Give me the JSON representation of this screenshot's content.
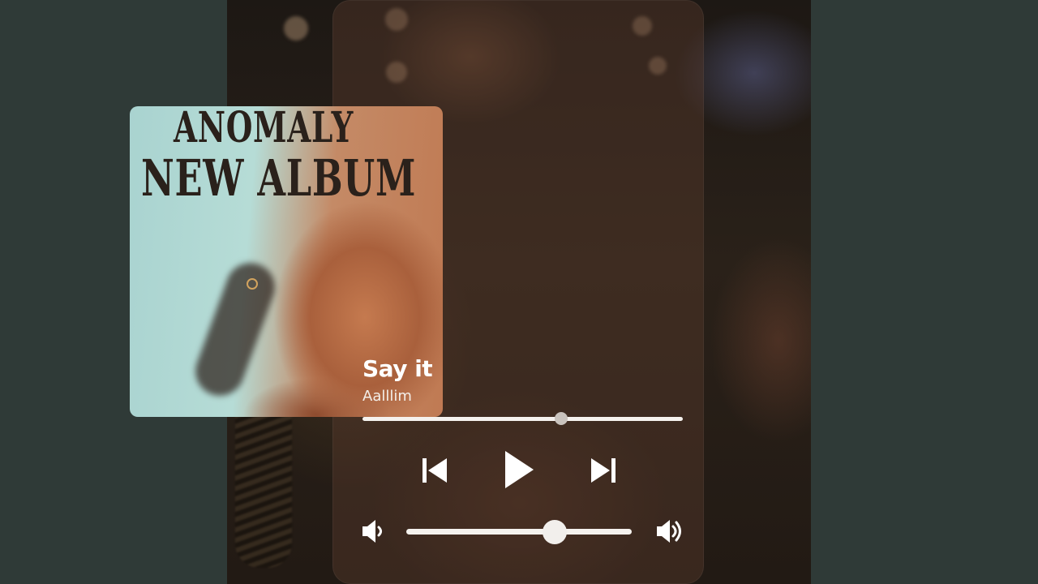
{
  "album_art": {
    "line1": "ANOMALY",
    "line2": "NEW ALBUM"
  },
  "track": {
    "title": "Say it",
    "artist": "Aalllim"
  },
  "playback": {
    "progress_fraction": 0.62,
    "state": "paused"
  },
  "volume": {
    "level_fraction": 0.66
  },
  "icons": {
    "previous": "skip-previous-icon",
    "play": "play-icon",
    "next": "skip-next-icon",
    "volume_low": "volume-low-icon",
    "volume_high": "volume-high-icon"
  },
  "colors": {
    "outer_background": "#2f3a37",
    "controls": "#ffffff",
    "track_bar": "#f5f2ee"
  }
}
